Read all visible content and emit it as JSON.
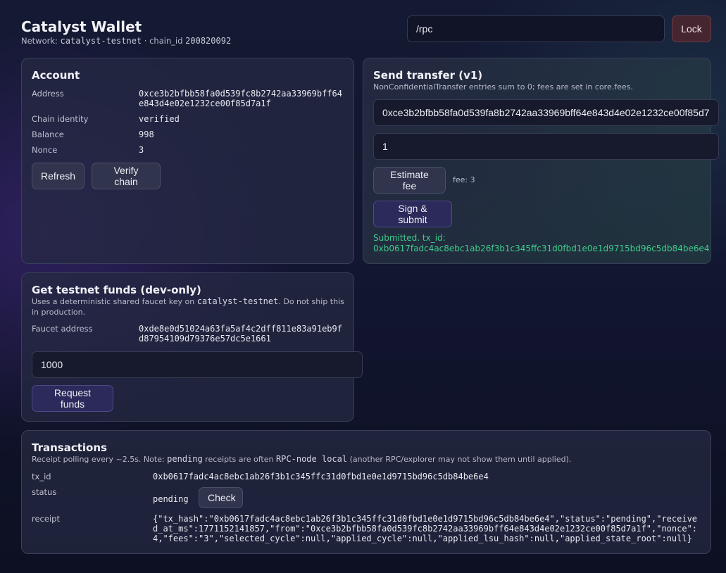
{
  "header": {
    "title": "Catalyst Wallet",
    "network_label": "Network:",
    "network": "catalyst-testnet",
    "chain_id_label": "· chain_id",
    "chain_id": "200820092",
    "rpc_value": "/rpc",
    "lock_label": "Lock"
  },
  "account": {
    "title": "Account",
    "address_label": "Address",
    "address": "0xce3b2bfbb58fa0d539fc8b2742aa33969bff64e843d4e02e1232ce00f85d7a1f",
    "chain_identity_label": "Chain identity",
    "chain_identity": "verified",
    "balance_label": "Balance",
    "balance": "998",
    "nonce_label": "Nonce",
    "nonce": "3",
    "refresh_label": "Refresh",
    "verify_label": "Verify chain"
  },
  "send": {
    "title": "Send transfer (v1)",
    "note": "NonConfidentialTransfer entries sum to 0; fees are set in core.fees.",
    "to_value": "0xce3b2bfbb58fa0d539fa8b2742aa33969bff64e843d4e02e1232ce00f85d7",
    "amount_value": "1",
    "estimate_label": "Estimate fee",
    "fee_text": "fee: 3",
    "submit_label": "Sign & submit",
    "result_prefix": "Submitted. tx_id:",
    "result_txid": "0xb0617fadc4ac8ebc1ab26f3b1c345ffc31d0fbd1e0e1d9715bd96c5db84be6e4"
  },
  "faucet": {
    "title": "Get testnet funds (dev-only)",
    "note_a": "Uses a deterministic shared faucet key on",
    "note_network": "catalyst-testnet",
    "note_b": ". Do not ship this in production.",
    "address_label": "Faucet address",
    "address": "0xde8e0d51024a63fa5af4c2dff811e83a91eb9fd87954109d79376e57dc5e1661",
    "amount_value": "1000",
    "request_label": "Request funds"
  },
  "transactions": {
    "title": "Transactions",
    "note_a": "Receipt polling every ~2.5s. Note:",
    "note_pending": "pending",
    "note_b": "receipts are often",
    "note_rpc": "RPC-node local",
    "note_c": "(another RPC/explorer may not show them until applied).",
    "txid_label": "tx_id",
    "txid": "0xb0617fadc4ac8ebc1ab26f3b1c345ffc31d0fbd1e0e1d9715bd96c5db84be6e4",
    "status_label": "status",
    "status": "pending",
    "check_label": "Check",
    "receipt_label": "receipt",
    "receipt": "{\"tx_hash\":\"0xb0617fadc4ac8ebc1ab26f3b1c345ffc31d0fbd1e0e1d9715bd96c5db84be6e4\",\"status\":\"pending\",\"received_at_ms\":1771152141857,\"from\":\"0xce3b2bfbb58fa0d539fc8b2742aa33969bff64e843d4e02e1232ce00f85d7a1f\",\"nonce\":4,\"fees\":\"3\",\"selected_cycle\":null,\"applied_cycle\":null,\"applied_lsu_hash\":null,\"applied_state_root\":null}"
  }
}
